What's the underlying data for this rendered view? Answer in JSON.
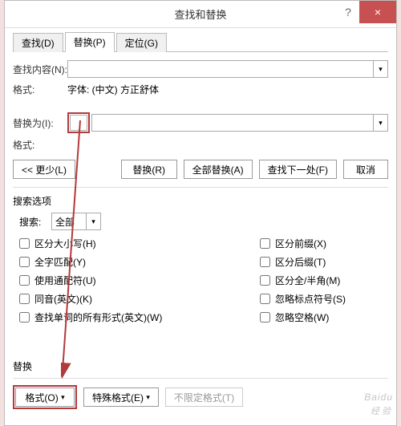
{
  "titlebar": {
    "title": "查找和替换",
    "help": "?",
    "close": "×"
  },
  "tabs": {
    "find": "查找(D)",
    "replace": "替换(P)",
    "goto": "定位(G)"
  },
  "find": {
    "content_label": "查找内容(N):",
    "content_value": "",
    "format_label": "格式:",
    "format_value": "字体: (中文) 方正舒体"
  },
  "replace": {
    "with_label": "替换为(I):",
    "with_value": "",
    "format_label": "格式:"
  },
  "buttons": {
    "less": "<< 更少(L)",
    "replace": "替换(R)",
    "replace_all": "全部替换(A)",
    "find_next": "查找下一处(F)",
    "cancel": "取消"
  },
  "options": {
    "heading": "搜索选项",
    "search_label": "搜索:",
    "search_value": "全部",
    "left": [
      "区分大小写(H)",
      "全字匹配(Y)",
      "使用通配符(U)",
      "同音(英文)(K)",
      "查找单词的所有形式(英文)(W)"
    ],
    "right": [
      "区分前缀(X)",
      "区分后缀(T)",
      "区分全/半角(M)",
      "忽略标点符号(S)",
      "忽略空格(W)"
    ]
  },
  "footer": {
    "heading": "替换",
    "format": "格式(O)",
    "special": "特殊格式(E)",
    "noformat": "不限定格式(T)"
  },
  "chevron": "▾",
  "watermark": {
    "main": "Baidu",
    "sub": "经验"
  }
}
